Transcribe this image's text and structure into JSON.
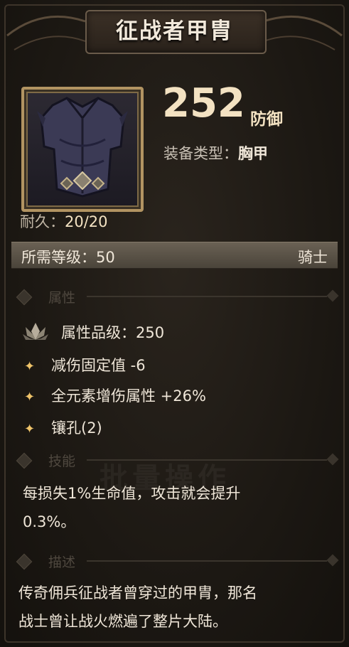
{
  "item": {
    "name": "征战者甲胄",
    "defense_value": "252",
    "defense_label": "防御",
    "type_key": "装备类型：",
    "type_value": "胸甲",
    "durability_key": "耐久：",
    "durability_value": "20/20",
    "required_level": "所需等级：50",
    "required_class": "骑士"
  },
  "sections": {
    "attributes": "属性",
    "skill": "技能",
    "description": "描述"
  },
  "attributes": {
    "grade": "属性品级：250",
    "items": [
      "减伤固定值 -6",
      "全元素增伤属性 +26%",
      "镶孔(2)"
    ]
  },
  "skill": {
    "line1": "每损失1%生命值，攻击就会提升",
    "line2": "0.3%。"
  },
  "description": {
    "line1": "传奇佣兵征战者曾穿过的甲胄，那名",
    "line2": "战士曾让战火燃遍了整片大陆。"
  },
  "watermark": "批量操作",
  "icons": {
    "item_image": "dark-chest-armor-icon",
    "grade": "lotus-emblem-icon",
    "bullet": "sparkle-icon"
  },
  "colors": {
    "gold_text": "#f3e2c2",
    "frame_gold": "#b29462",
    "bullet": "#f0c46a"
  }
}
